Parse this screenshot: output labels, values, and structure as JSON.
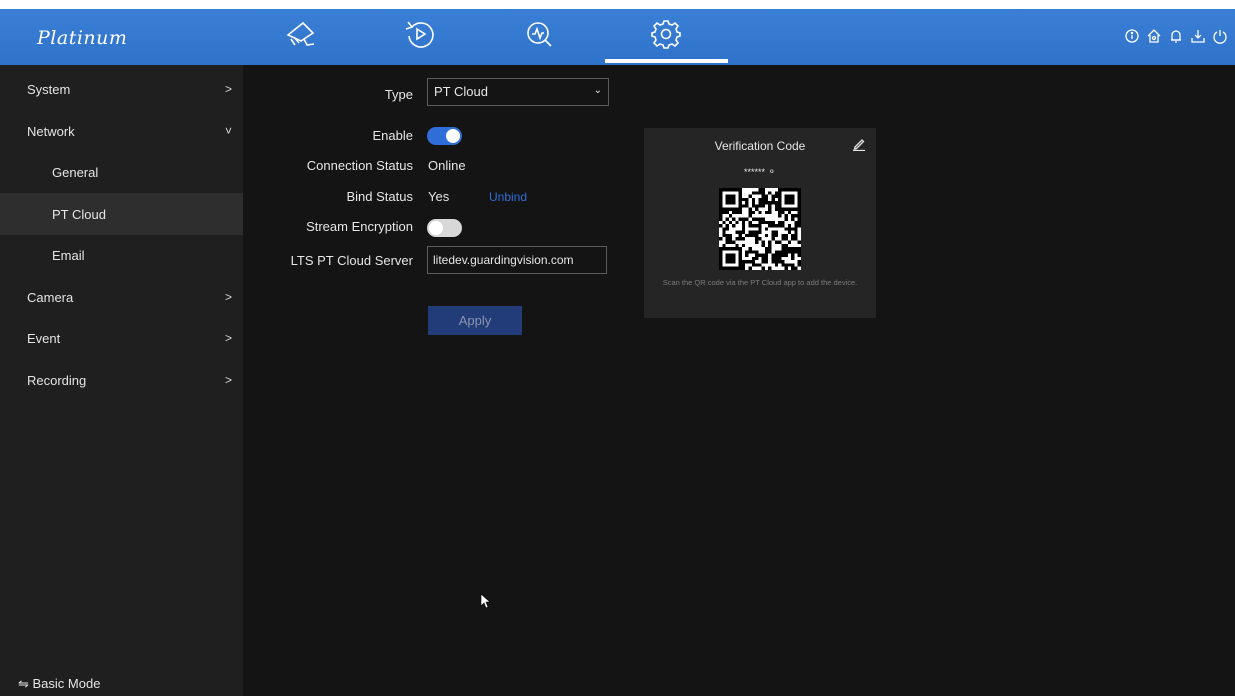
{
  "brand": {
    "logo_text": "Platinum"
  },
  "topnav": {
    "items": [
      {
        "name": "live-view",
        "icon": "camera-icon"
      },
      {
        "name": "playback",
        "icon": "playback-icon"
      },
      {
        "name": "smart-analysis",
        "icon": "search-analytics-icon"
      },
      {
        "name": "configuration",
        "icon": "gear-icon",
        "active": true
      }
    ],
    "right_icons": [
      "info-icon",
      "home-icon",
      "bell-icon",
      "download-icon",
      "power-icon"
    ]
  },
  "sidebar": {
    "items": [
      {
        "label": "System",
        "chevron": ">"
      },
      {
        "label": "Network",
        "chevron": "˅"
      },
      {
        "label": "General",
        "sub": true
      },
      {
        "label": "PT Cloud",
        "sub": true,
        "active": true
      },
      {
        "label": "Email",
        "sub": true
      },
      {
        "label": "Camera",
        "chevron": ">"
      },
      {
        "label": "Event",
        "chevron": ">"
      },
      {
        "label": "Recording",
        "chevron": ">"
      }
    ],
    "footer": "⇋ Basic Mode"
  },
  "form": {
    "type_label": "Type",
    "type_value": "PT Cloud",
    "enable_label": "Enable",
    "enable_on": true,
    "connection_status_label": "Connection Status",
    "connection_status_value": "Online",
    "bind_status_label": "Bind Status",
    "bind_status_value": "Yes",
    "unbind_link": "Unbind",
    "stream_encryption_label": "Stream Encryption",
    "stream_encryption_on": false,
    "server_label": "LTS PT Cloud Server",
    "server_value": "litedev.guardingvision.com",
    "apply_label": "Apply"
  },
  "qr_panel": {
    "title": "Verification Code",
    "code_mask": "******",
    "caption": "Scan the QR code via the PT Cloud app to add the device."
  },
  "colors": {
    "topbar": "#3a7fd6",
    "toggle_on": "#2f6ed8",
    "toggle_off": "#d8d8d8",
    "link": "#2f6ed8",
    "apply_bg": "#223c7a"
  }
}
